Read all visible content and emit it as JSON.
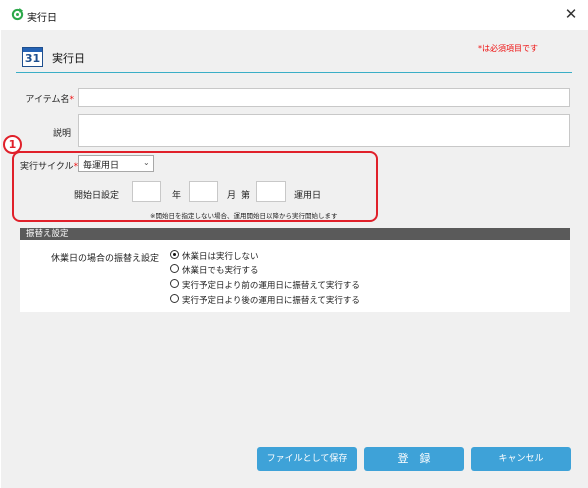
{
  "window": {
    "title": "実行日",
    "close_glyph": "✕"
  },
  "header": {
    "calendar_number": "31",
    "title": "実行日",
    "required_note": "*は必須項目です"
  },
  "form": {
    "item_name_label": "アイテム名",
    "required_mark": "*",
    "item_name_value": "",
    "description_label": "説明",
    "description_value": "",
    "cycle_label": "実行サイクル",
    "cycle_selected": "毎運用日",
    "start_label": "開始日設定",
    "year_value": "",
    "year_label": "年",
    "month_value": "",
    "month_label": "月",
    "nth_label": "第",
    "day_value": "",
    "day_label": "運用日",
    "hint": "※開始日を指定しない場合、運用開始日以降から実行開始します"
  },
  "annotation": {
    "number": "1"
  },
  "transfer": {
    "section_title": "振替え設定",
    "label": "休業日の場合の振替え設定",
    "options": [
      {
        "label": "休業日は実行しない",
        "checked": true
      },
      {
        "label": "休業日でも実行する",
        "checked": false
      },
      {
        "label": "実行予定日より前の運用日に振替えて実行する",
        "checked": false
      },
      {
        "label": "実行予定日より後の運用日に振替えて実行する",
        "checked": false
      }
    ]
  },
  "buttons": {
    "save_file": "ファイルとして保存",
    "register": "登　録",
    "cancel": "キャンセル"
  },
  "colors": {
    "accent": "#3ea2d8",
    "required": "#e11111",
    "annotation": "#e0202a",
    "panel_header": "#5a5a5a",
    "title_rule": "#3aaec6"
  }
}
